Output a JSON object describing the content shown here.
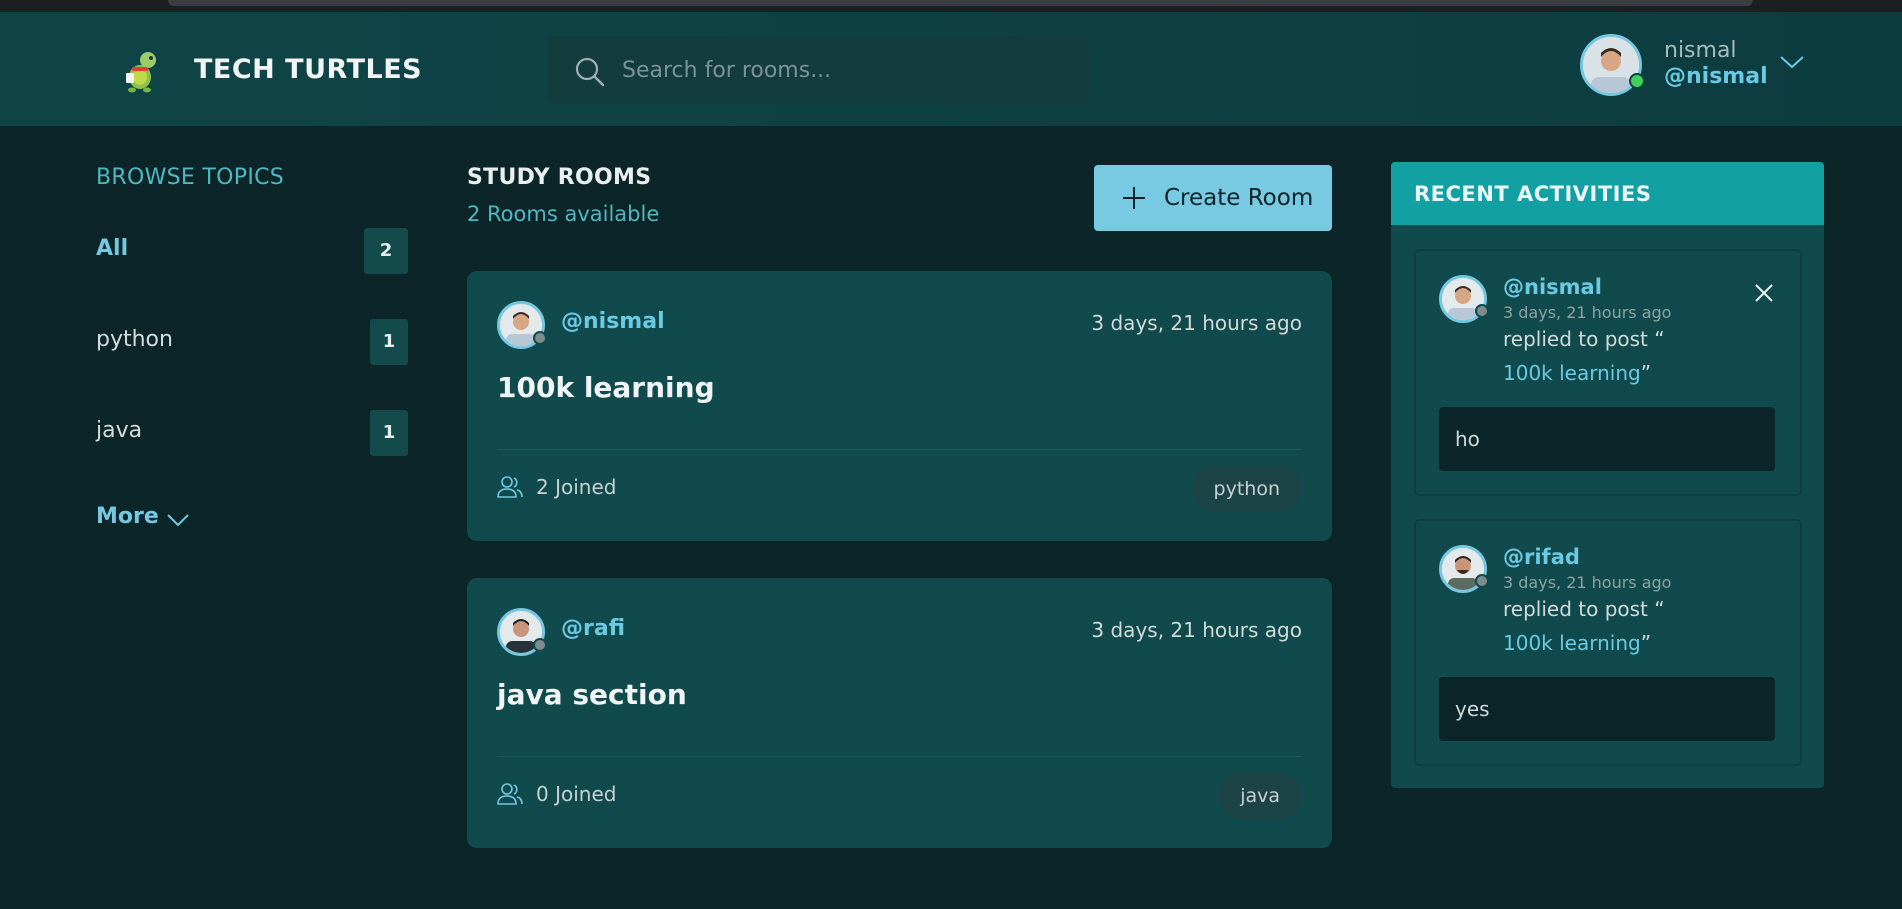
{
  "header": {
    "brand": "TECH TURTLES",
    "search_placeholder": "Search for rooms...",
    "user": {
      "name": "nismal",
      "handle": "@nismal",
      "status_color": "#3fd25a"
    }
  },
  "sidebar": {
    "title": "BROWSE TOPICS",
    "topics": [
      {
        "name": "All",
        "count": "2"
      },
      {
        "name": "python",
        "count": "1"
      },
      {
        "name": "java",
        "count": "1"
      }
    ],
    "more_label": "More"
  },
  "main": {
    "title": "STUDY ROOMS",
    "subtitle": "2 Rooms available",
    "create_label": "Create Room",
    "rooms": [
      {
        "host": "@nismal",
        "time": "3 days, 21 hours ago",
        "title": "100k learning",
        "joined": "2 Joined",
        "topic": "python"
      },
      {
        "host": "@rafi",
        "time": "3 days, 21 hours ago",
        "title": "java section",
        "joined": "0 Joined",
        "topic": "java"
      }
    ]
  },
  "activities": {
    "title": "RECENT ACTIVITIES",
    "items": [
      {
        "handle": "@nismal",
        "time": "3 days, 21 hours ago",
        "action": "replied to post “",
        "post": "100k learning",
        "post_close": "”",
        "reply": "ho"
      },
      {
        "handle": "@rifad",
        "time": "3 days, 21 hours ago",
        "action": "replied to post “",
        "post": "100k learning",
        "post_close": "”",
        "reply": "yes"
      }
    ]
  },
  "colors": {
    "background": "#0b2528",
    "header": "#0f4447",
    "card": "#114a4d",
    "accent": "#76c7e0",
    "teal_text": "#4fb8c2",
    "activity_header": "#13a0a3"
  }
}
